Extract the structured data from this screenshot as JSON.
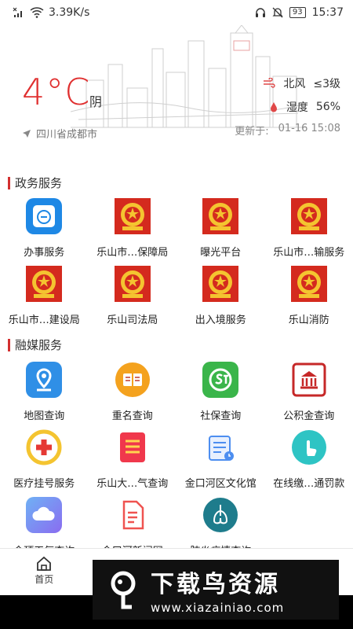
{
  "status": {
    "network_speed": "3.39K/s",
    "battery": "93",
    "time": "15:37"
  },
  "weather": {
    "temperature": "4°C",
    "condition": "阴",
    "location": "四川省成都市",
    "wind": {
      "label": "北风",
      "value": "≤3级"
    },
    "humidity": {
      "label": "湿度",
      "value": "56%"
    },
    "updated_label": "更新于:",
    "updated_time": "01-16 15:08"
  },
  "gov_section": {
    "title": "政务服务",
    "items": [
      {
        "label": "办事服务",
        "icon": "service-icon"
      },
      {
        "label": "乐山市…保障局",
        "icon": "emblem-icon"
      },
      {
        "label": "曝光平台",
        "icon": "emblem-icon"
      },
      {
        "label": "乐山市…输服务",
        "icon": "emblem-icon"
      },
      {
        "label": "乐山市…建设局",
        "icon": "emblem-icon"
      },
      {
        "label": "乐山司法局",
        "icon": "emblem-icon"
      },
      {
        "label": "出入境服务",
        "icon": "emblem-icon"
      },
      {
        "label": "乐山消防",
        "icon": "emblem-icon"
      }
    ]
  },
  "media_section": {
    "title": "融媒服务",
    "items": [
      {
        "label": "地图查询",
        "icon": "map-pin-icon",
        "color": "#2f8fe6"
      },
      {
        "label": "重名查询",
        "icon": "book-icon",
        "color": "#f4a21e"
      },
      {
        "label": "社保查询",
        "icon": "social-security-icon",
        "color": "#3ab54a"
      },
      {
        "label": "公积金查询",
        "icon": "bank-icon",
        "color": "#c62828"
      },
      {
        "label": "医疗挂号服务",
        "icon": "medical-cross-icon",
        "color": "#e53935"
      },
      {
        "label": "乐山大…气查询",
        "icon": "list-icon",
        "color": "#f0384c"
      },
      {
        "label": "金口河区文化馆",
        "icon": "calendar-icon",
        "color": "#4d8ef0"
      },
      {
        "label": "在线缴…通罚款",
        "icon": "tap-icon",
        "color": "#2ec4c4"
      },
      {
        "label": "金顶天气查询",
        "icon": "cloud-icon",
        "color": "#6b8cf2"
      },
      {
        "label": "金口河新闻网",
        "icon": "document-icon",
        "color": "#ef5350"
      },
      {
        "label": "肺炎疫情查询",
        "icon": "lungs-icon",
        "color": "#1e7c8c"
      }
    ]
  },
  "bottom_nav": {
    "home_label": "首页"
  },
  "watermark": {
    "title": "下载鸟资源",
    "url": "www.xiazainiao.com"
  }
}
